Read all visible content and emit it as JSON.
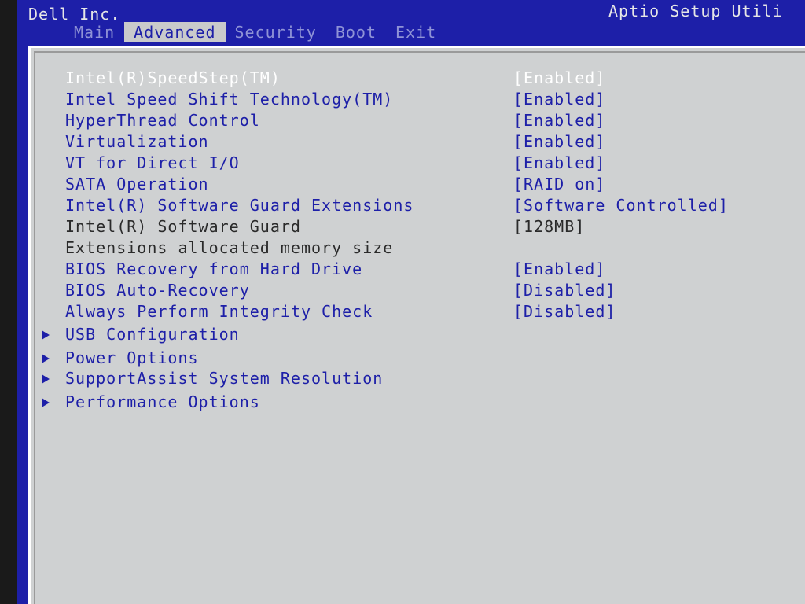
{
  "header": {
    "vendor": "Dell Inc.",
    "utility_title": "Aptio Setup Utili"
  },
  "tabs": [
    {
      "label": "Main",
      "active": false
    },
    {
      "label": "Advanced",
      "active": true
    },
    {
      "label": "Security",
      "active": false
    },
    {
      "label": "Boot",
      "active": false
    },
    {
      "label": "Exit",
      "active": false
    }
  ],
  "settings": [
    {
      "label": "Intel(R)SpeedStep(TM)",
      "value": "[Enabled]"
    },
    {
      "label": "Intel Speed Shift Technology(TM)",
      "value": "[Enabled]"
    },
    {
      "label": "HyperThread Control",
      "value": "[Enabled]"
    },
    {
      "label": "Virtualization",
      "value": "[Enabled]"
    },
    {
      "label": "VT for Direct I/O",
      "value": "[Enabled]"
    },
    {
      "label": "SATA Operation",
      "value": "[RAID on]"
    },
    {
      "label": "Intel(R) Software Guard Extensions",
      "value": "[Software Controlled]"
    },
    {
      "label": "Intel(R) Software Guard",
      "value": "[128MB]"
    },
    {
      "label": "Extensions allocated memory size",
      "value": ""
    },
    {
      "label": "BIOS Recovery from Hard Drive",
      "value": "[Enabled]"
    },
    {
      "label": "BIOS Auto-Recovery",
      "value": "[Disabled]"
    },
    {
      "label": "Always Perform Integrity Check",
      "value": "[Disabled]"
    }
  ],
  "submenus": [
    {
      "label": "USB Configuration"
    },
    {
      "label": "Power Options"
    },
    {
      "label": "SupportAssist System Resolution"
    },
    {
      "label": "Performance Options"
    }
  ],
  "colors": {
    "bios_blue": "#1d1fa8",
    "panel_gray": "#cfd1d2",
    "selected_text": "#ffffff",
    "static_text": "#2a2a2a"
  }
}
